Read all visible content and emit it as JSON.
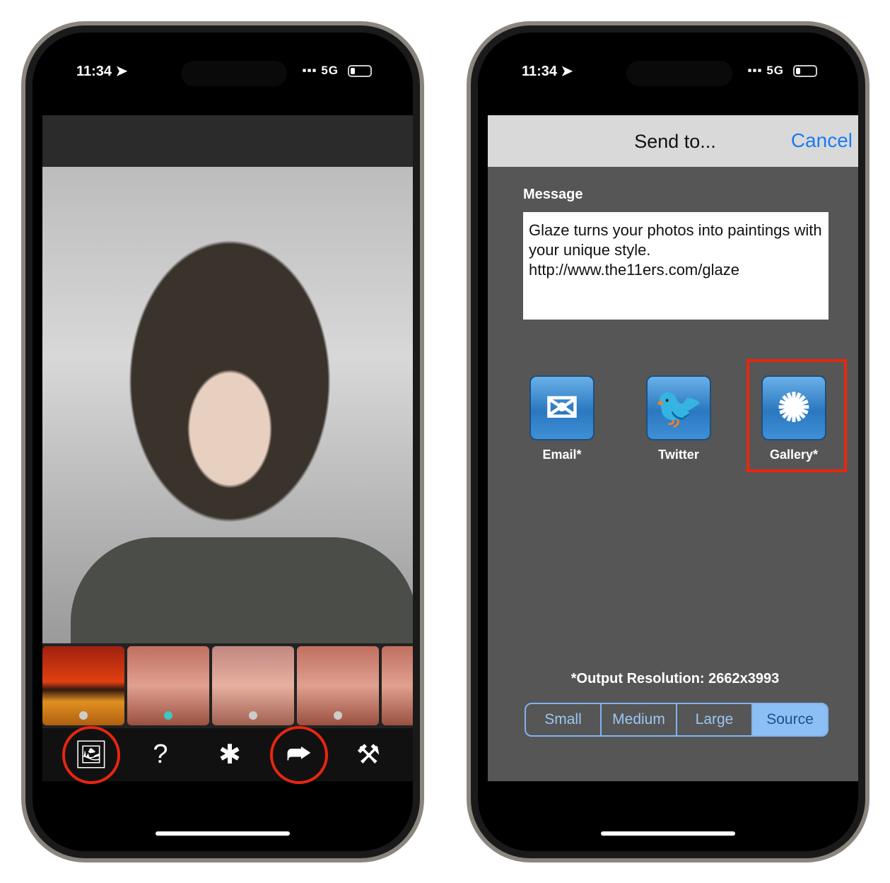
{
  "status": {
    "time": "11:34 ➤",
    "network": "5G"
  },
  "left": {
    "toolbar": [
      {
        "icon": "photos-icon",
        "glyph": "🖼",
        "highlighted": true
      },
      {
        "icon": "help-icon",
        "glyph": "?",
        "highlighted": false
      },
      {
        "icon": "splat-icon",
        "glyph": "✱",
        "highlighted": false
      },
      {
        "icon": "share-icon",
        "glyph": "⮫",
        "highlighted": true
      },
      {
        "icon": "tools-icon",
        "glyph": "⚒",
        "highlighted": false
      }
    ]
  },
  "right": {
    "title": "Send to...",
    "cancel": "Cancel",
    "message_label": "Message",
    "message": "Glaze turns your photos into paintings with your unique style. http://www.the11ers.com/glaze",
    "share": [
      {
        "label": "Email*",
        "icon": "email-icon",
        "glyph": "✉"
      },
      {
        "label": "Twitter",
        "icon": "twitter-icon",
        "glyph": "🐦"
      },
      {
        "label": "Gallery*",
        "icon": "gallery-sunflower-icon",
        "glyph": "✺"
      }
    ],
    "resolution": "*Output Resolution: 2662x3993",
    "sizes": [
      "Small",
      "Medium",
      "Large",
      "Source"
    ],
    "selected_size": "Source"
  },
  "colors": {
    "highlight": "#e8260f",
    "accent": "#1a7cf0"
  }
}
